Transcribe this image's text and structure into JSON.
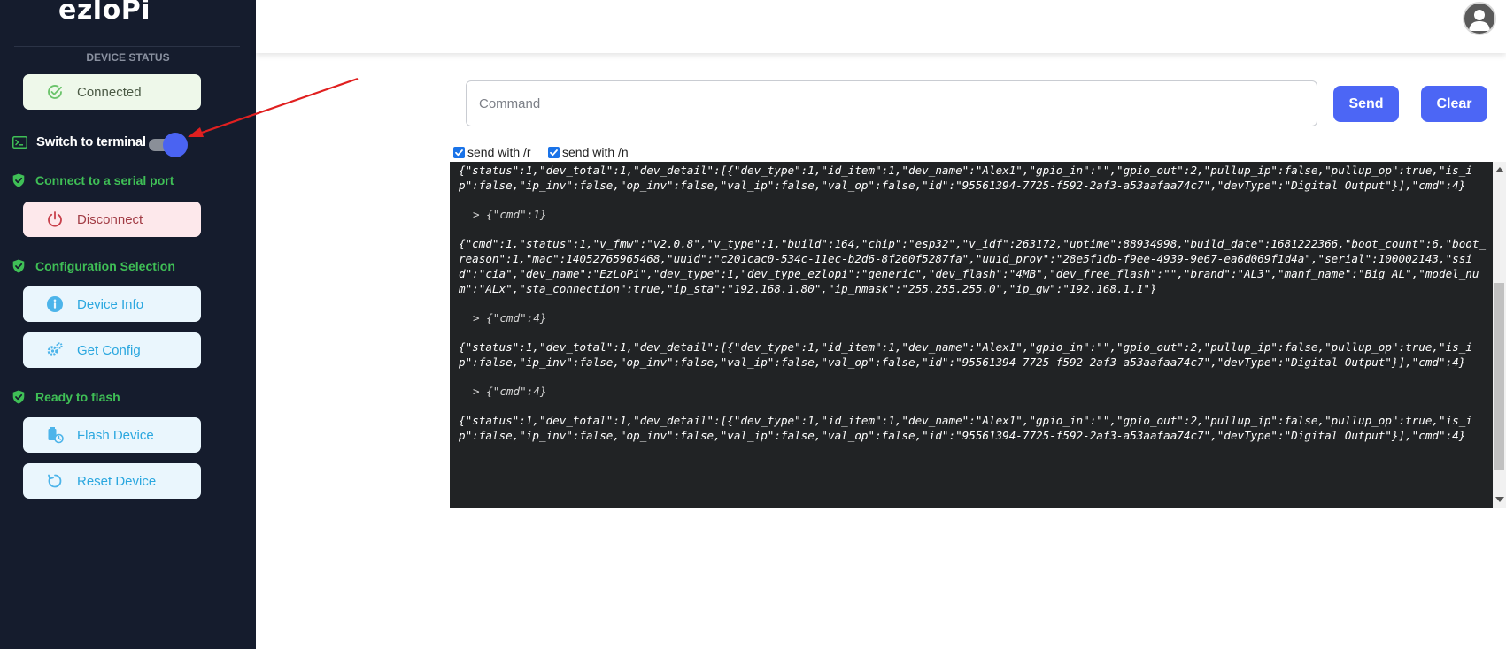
{
  "sidebar": {
    "logo": "ezloPi",
    "device_status_label": "DEVICE STATUS",
    "connected_label": "Connected",
    "switch_label": "Switch to terminal",
    "switch_on": true,
    "section_serial": "Connect to a serial port",
    "disconnect_label": "Disconnect",
    "section_config": "Configuration Selection",
    "device_info_label": "Device Info",
    "get_config_label": "Get Config",
    "section_flash": "Ready to flash",
    "flash_label": "Flash Device",
    "reset_label": "Reset Device"
  },
  "command": {
    "placeholder": "Command",
    "send_label": "Send",
    "clear_label": "Clear",
    "send_r_label": "send with /r",
    "send_n_label": "send with /n",
    "send_r_checked": true,
    "send_n_checked": true
  },
  "terminal": {
    "lines": [
      "{\"status\":1,\"dev_total\":1,\"dev_detail\":[{\"dev_type\":1,\"id_item\":1,\"dev_name\":\"Alex1\",\"gpio_in\":\"\",\"gpio_out\":2,\"pullup_ip\":false,\"pullup_op\":true,\"is_ip\":false,\"ip_inv\":false,\"op_inv\":false,\"val_ip\":false,\"val_op\":false,\"id\":\"95561394-7725-f592-2af3-a53aafaa74c7\",\"devType\":\"Digital Output\"}],\"cmd\":4}",
      "> {\"cmd\":1}",
      "{\"cmd\":1,\"status\":1,\"v_fmw\":\"v2.0.8\",\"v_type\":1,\"build\":164,\"chip\":\"esp32\",\"v_idf\":263172,\"uptime\":88934998,\"build_date\":1681222366,\"boot_count\":6,\"boot_reason\":1,\"mac\":14052765965468,\"uuid\":\"c201cac0-534c-11ec-b2d6-8f260f5287fa\",\"uuid_prov\":\"28e5f1db-f9ee-4939-9e67-ea6d069f1d4a\",\"serial\":100002143,\"ssid\":\"cia\",\"dev_name\":\"EzLoPi\",\"dev_type\":1,\"dev_type_ezlopi\":\"generic\",\"dev_flash\":\"4MB\",\"dev_free_flash\":\"\",\"brand\":\"AL3\",\"manf_name\":\"Big AL\",\"model_num\":\"ALx\",\"sta_connection\":true,\"ip_sta\":\"192.168.1.80\",\"ip_nmask\":\"255.255.255.0\",\"ip_gw\":\"192.168.1.1\"}",
      "> {\"cmd\":4}",
      "{\"status\":1,\"dev_total\":1,\"dev_detail\":[{\"dev_type\":1,\"id_item\":1,\"dev_name\":\"Alex1\",\"gpio_in\":\"\",\"gpio_out\":2,\"pullup_ip\":false,\"pullup_op\":true,\"is_ip\":false,\"ip_inv\":false,\"op_inv\":false,\"val_ip\":false,\"val_op\":false,\"id\":\"95561394-7725-f592-2af3-a53aafaa74c7\",\"devType\":\"Digital Output\"}],\"cmd\":4}",
      "> {\"cmd\":4}",
      "{\"status\":1,\"dev_total\":1,\"dev_detail\":[{\"dev_type\":1,\"id_item\":1,\"dev_name\":\"Alex1\",\"gpio_in\":\"\",\"gpio_out\":2,\"pullup_ip\":false,\"pullup_op\":true,\"is_ip\":false,\"ip_inv\":false,\"op_inv\":false,\"val_ip\":false,\"val_op\":false,\"id\":\"95561394-7725-f592-2af3-a53aafaa74c7\",\"devType\":\"Digital Output\"}],\"cmd\":4}"
    ]
  },
  "icons": {
    "connected": "check-circle-icon",
    "terminal": "terminal-icon",
    "shield": "shield-check-icon",
    "disconnect": "power-icon",
    "info": "info-circle-icon",
    "config": "gears-icon",
    "flash": "flash-device-icon",
    "reset": "reset-icon",
    "avatar": "user-avatar-icon",
    "annotation": "red-arrow-annotation"
  },
  "colors": {
    "sidebar_bg": "#151c2d",
    "accent": "#4c66f5",
    "section_green": "#3fbf56",
    "info_blue": "#2aa7df",
    "disconnect_red": "#a23c45",
    "terminal_bg": "#212325",
    "annotation_red": "#e02020"
  }
}
